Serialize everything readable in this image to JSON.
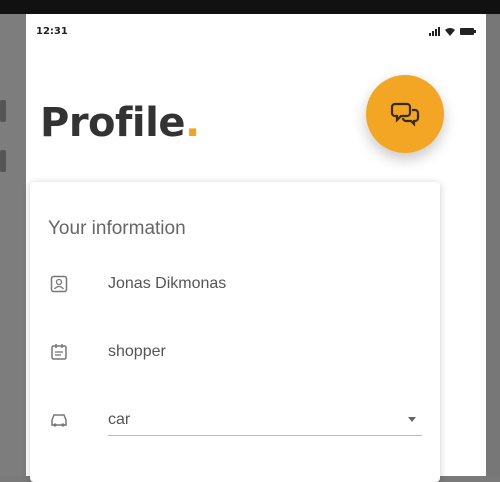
{
  "status_bar": {
    "time": "12:31"
  },
  "header": {
    "title": "Profile",
    "title_dot": "."
  },
  "fab": {
    "icon": "chat-bubbles-icon",
    "color": "#f2a624"
  },
  "info_card": {
    "title": "Your information",
    "name": "Jonas Dikmonas",
    "role": "shopper",
    "transport": {
      "selected": "car"
    }
  },
  "colors": {
    "accent": "#f2a320",
    "title_text": "#333333"
  }
}
